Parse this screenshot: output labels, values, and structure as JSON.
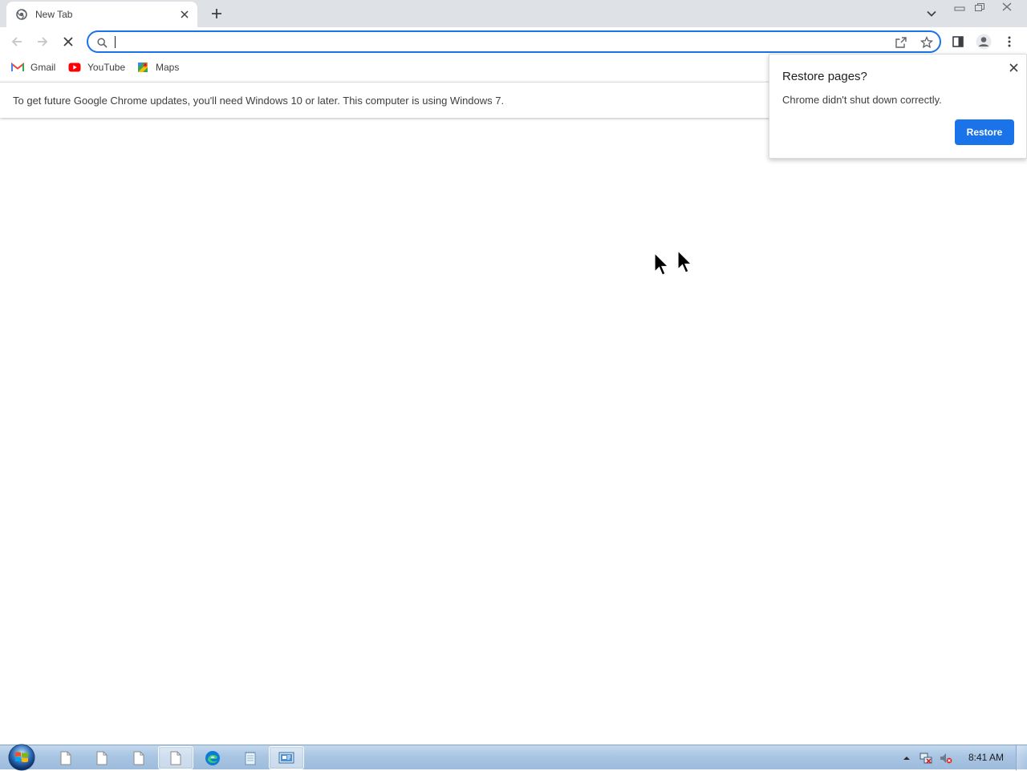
{
  "tab": {
    "title": "New Tab"
  },
  "omnibox": {
    "value": "",
    "placeholder": ""
  },
  "bookmarks": [
    {
      "label": "Gmail",
      "icon": "gmail-icon"
    },
    {
      "label": "YouTube",
      "icon": "youtube-icon"
    },
    {
      "label": "Maps",
      "icon": "maps-icon"
    }
  ],
  "infobar": {
    "message": "To get future Google Chrome updates, you'll need Windows 10 or later. This computer is using Windows 7."
  },
  "restore_bubble": {
    "title": "Restore pages?",
    "body": "Chrome didn't shut down correctly.",
    "button_label": "Restore"
  },
  "taskbar": {
    "clock": "8:41 AM",
    "items": [
      "file-icon",
      "file-icon",
      "file-icon",
      "file-icon",
      "edge-icon",
      "notepad-icon",
      "network-app-icon"
    ]
  },
  "colors": {
    "accent": "#1a73e8",
    "tabstrip": "#dee1e6",
    "taskbar": "#a9c5e3"
  }
}
